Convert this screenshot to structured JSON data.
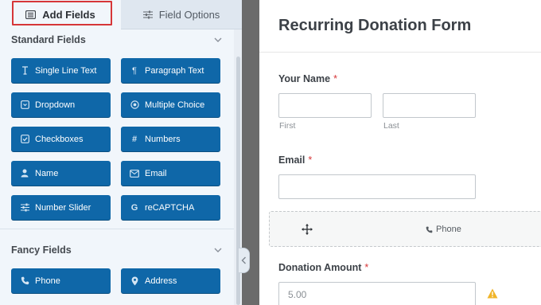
{
  "sidebar": {
    "tabs": {
      "add_fields": "Add Fields",
      "field_options": "Field Options"
    },
    "standard_group": {
      "title": "Standard Fields",
      "fields": [
        {
          "label": "Single Line Text",
          "icon": "text-cursor-icon"
        },
        {
          "label": "Paragraph Text",
          "icon": "paragraph-icon"
        },
        {
          "label": "Dropdown",
          "icon": "dropdown-icon"
        },
        {
          "label": "Multiple Choice",
          "icon": "radio-icon"
        },
        {
          "label": "Checkboxes",
          "icon": "checkbox-icon"
        },
        {
          "label": "Numbers",
          "icon": "hash-icon"
        },
        {
          "label": "Name",
          "icon": "user-icon"
        },
        {
          "label": "Email",
          "icon": "envelope-icon"
        },
        {
          "label": "Number Slider",
          "icon": "sliders-icon"
        },
        {
          "label": "reCAPTCHA",
          "icon": "google-icon"
        }
      ]
    },
    "fancy_group": {
      "title": "Fancy Fields",
      "fields": [
        {
          "label": "Phone",
          "icon": "phone-icon"
        },
        {
          "label": "Address",
          "icon": "map-pin-icon"
        }
      ]
    }
  },
  "form": {
    "title": "Recurring Donation Form",
    "name_field": {
      "label": "Your Name",
      "required": "*",
      "first_sublabel": "First",
      "last_sublabel": "Last"
    },
    "email_field": {
      "label": "Email",
      "required": "*"
    },
    "phone_placeholder": {
      "label": "Phone"
    },
    "donation_field": {
      "label": "Donation Amount",
      "required": "*",
      "value": "5.00"
    }
  },
  "colors": {
    "button_blue": "#0f67a8",
    "active_outline": "#d63638",
    "required_star": "#d63638",
    "warning": "#f0b429"
  }
}
